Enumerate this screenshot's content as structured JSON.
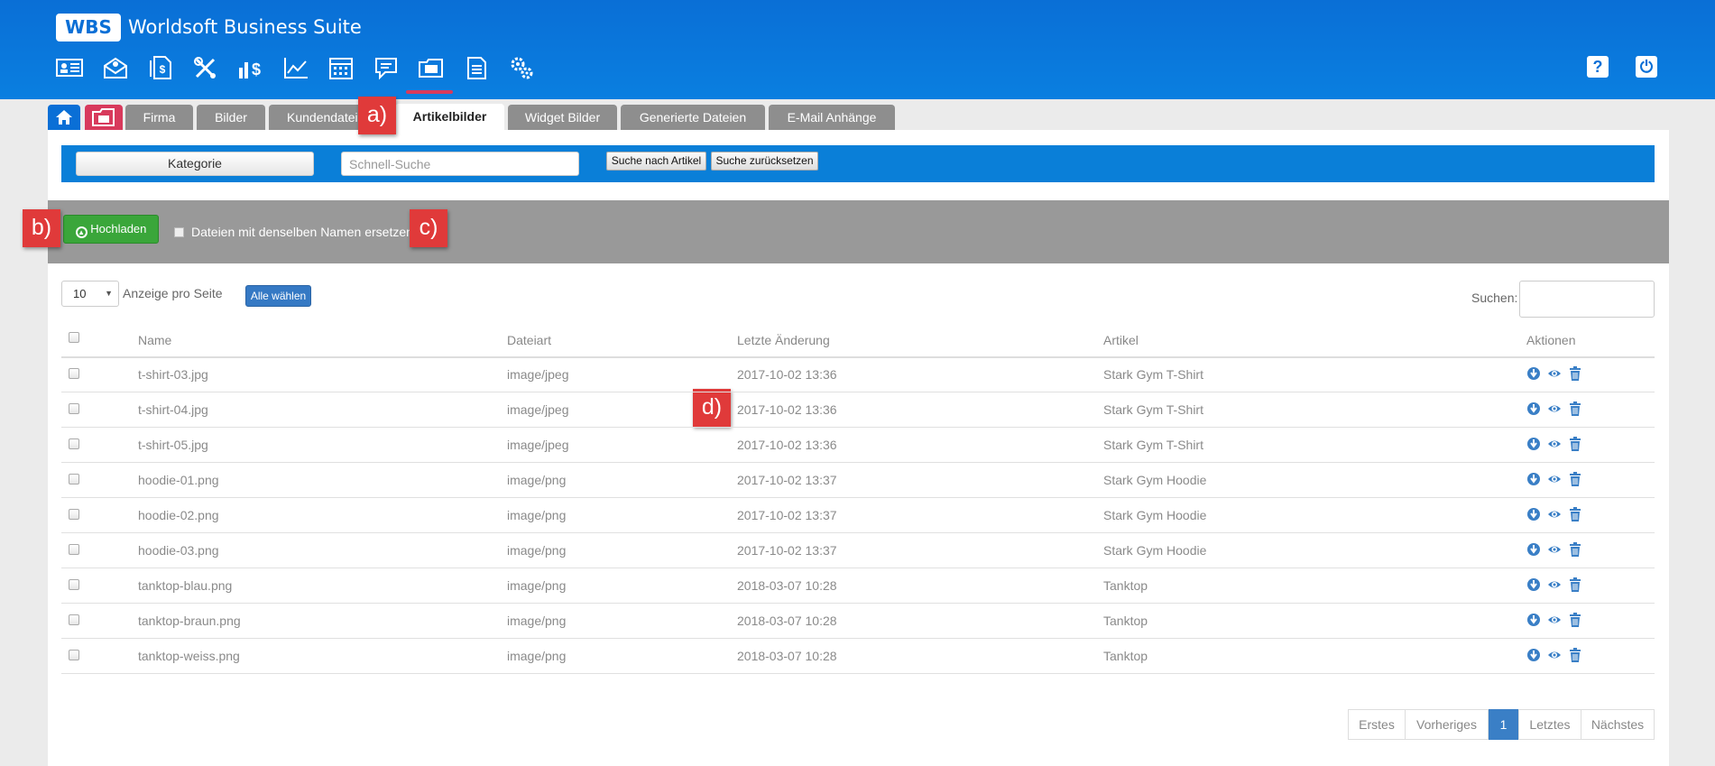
{
  "header": {
    "logo": "WBS",
    "title": "Worldsoft Business Suite",
    "module_icons": [
      "contact-card-icon",
      "mail-settings-icon",
      "documents-dollar-icon",
      "tools-icon",
      "finance-icon",
      "chart-icon",
      "calendar-icon",
      "comment-icon",
      "file-manager-icon",
      "print-documents-icon",
      "settings-gears-icon"
    ],
    "help_label": "?",
    "power_label": "⏻"
  },
  "tabs": {
    "firma": "Firma",
    "bilder": "Bilder",
    "kundendateien": "Kundendateien",
    "artikelbilder": "Artikelbilder",
    "widget_bilder": "Widget Bilder",
    "generierte_dateien": "Generierte Dateien",
    "email_anhaenge": "E-Mail Anhänge"
  },
  "toolbar": {
    "kategorie": "Kategorie",
    "quick_search_placeholder": "Schnell-Suche",
    "search_by_article": "Suche nach Artikel",
    "reset_search": "Suche zurücksetzen"
  },
  "upload": {
    "button": "Hochladen",
    "replace_label": "Dateien mit denselben Namen ersetzen"
  },
  "callouts": {
    "a": "a)",
    "b": "b)",
    "c": "c)",
    "d": "d)"
  },
  "list_controls": {
    "per_page": "10",
    "per_page_label": "Anzeige pro Seite",
    "select_all": "Alle wählen",
    "search_label": "Suchen:"
  },
  "table": {
    "columns": [
      "Name",
      "Dateiart",
      "Letzte Änderung",
      "Artikel",
      "Aktionen"
    ],
    "rows": [
      {
        "name": "t-shirt-03.jpg",
        "type": "image/jpeg",
        "modified": "2017-10-02 13:36",
        "article": "Stark Gym T-Shirt"
      },
      {
        "name": "t-shirt-04.jpg",
        "type": "image/jpeg",
        "modified": "2017-10-02 13:36",
        "article": "Stark Gym T-Shirt"
      },
      {
        "name": "t-shirt-05.jpg",
        "type": "image/jpeg",
        "modified": "2017-10-02 13:36",
        "article": "Stark Gym T-Shirt"
      },
      {
        "name": "hoodie-01.png",
        "type": "image/png",
        "modified": "2017-10-02 13:37",
        "article": "Stark Gym Hoodie"
      },
      {
        "name": "hoodie-02.png",
        "type": "image/png",
        "modified": "2017-10-02 13:37",
        "article": "Stark Gym Hoodie"
      },
      {
        "name": "hoodie-03.png",
        "type": "image/png",
        "modified": "2017-10-02 13:37",
        "article": "Stark Gym Hoodie"
      },
      {
        "name": "tanktop-blau.png",
        "type": "image/png",
        "modified": "2018-03-07 10:28",
        "article": "Tanktop"
      },
      {
        "name": "tanktop-braun.png",
        "type": "image/png",
        "modified": "2018-03-07 10:28",
        "article": "Tanktop"
      },
      {
        "name": "tanktop-weiss.png",
        "type": "image/png",
        "modified": "2018-03-07 10:28",
        "article": "Tanktop"
      }
    ]
  },
  "pagination": {
    "first": "Erstes",
    "previous": "Vorheriges",
    "current": "1",
    "last": "Letztes",
    "next": "Nächstes"
  },
  "colors": {
    "header_blue": "#0a7fe0",
    "accent_pink": "#d83a5c",
    "callout_red": "#e03a3a",
    "upload_green": "#3aa63a",
    "action_blue": "#3a7fc6"
  }
}
